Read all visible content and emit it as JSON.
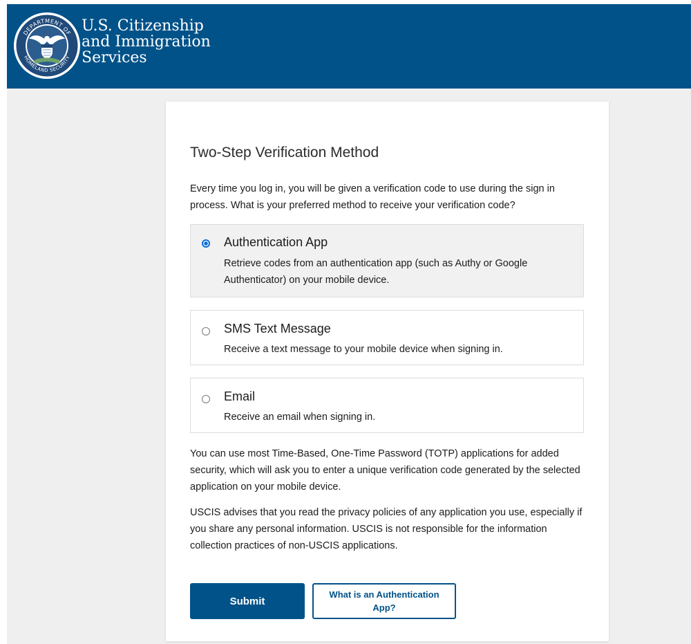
{
  "header": {
    "brand_line1": "U.S. Citizenship",
    "brand_line2": "and Immigration",
    "brand_line3": "Services",
    "seal_top_text": "DEPARTMENT OF",
    "seal_bottom_text": "HOMELAND SECURITY",
    "seal_icon": "dhs-seal-icon",
    "background_color": "#005288"
  },
  "page": {
    "title": "Two-Step Verification Method",
    "intro": "Every time you log in, you will be given a verification code to use during the sign in process. What is your preferred method to receive your verification code?"
  },
  "options": [
    {
      "label": "Authentication App",
      "description": "Retrieve codes from an authentication app (such as Authy or Google Authenticator) on your mobile device.",
      "selected": true
    },
    {
      "label": "SMS Text Message",
      "description": "Receive a text message to your mobile device when signing in.",
      "selected": false
    },
    {
      "label": "Email",
      "description": "Receive an email when signing in.",
      "selected": false
    }
  ],
  "info": {
    "paragraph1": "You can use most Time-Based, One-Time Password (TOTP) applications for added security, which will ask you to enter a unique verification code generated by the selected application on your mobile device.",
    "paragraph2": "USCIS advises that you read the privacy policies of any application you use, especially if you share any personal information. USCIS is not responsible for the information collection practices of non-USCIS applications."
  },
  "buttons": {
    "submit_label": "Submit",
    "auth_app_label": "What is an Authentication App?"
  },
  "colors": {
    "primary": "#005288",
    "radio_selected": "#0b6cd9",
    "page_background": "#efefef",
    "selected_option_background": "#f1f1f1"
  }
}
